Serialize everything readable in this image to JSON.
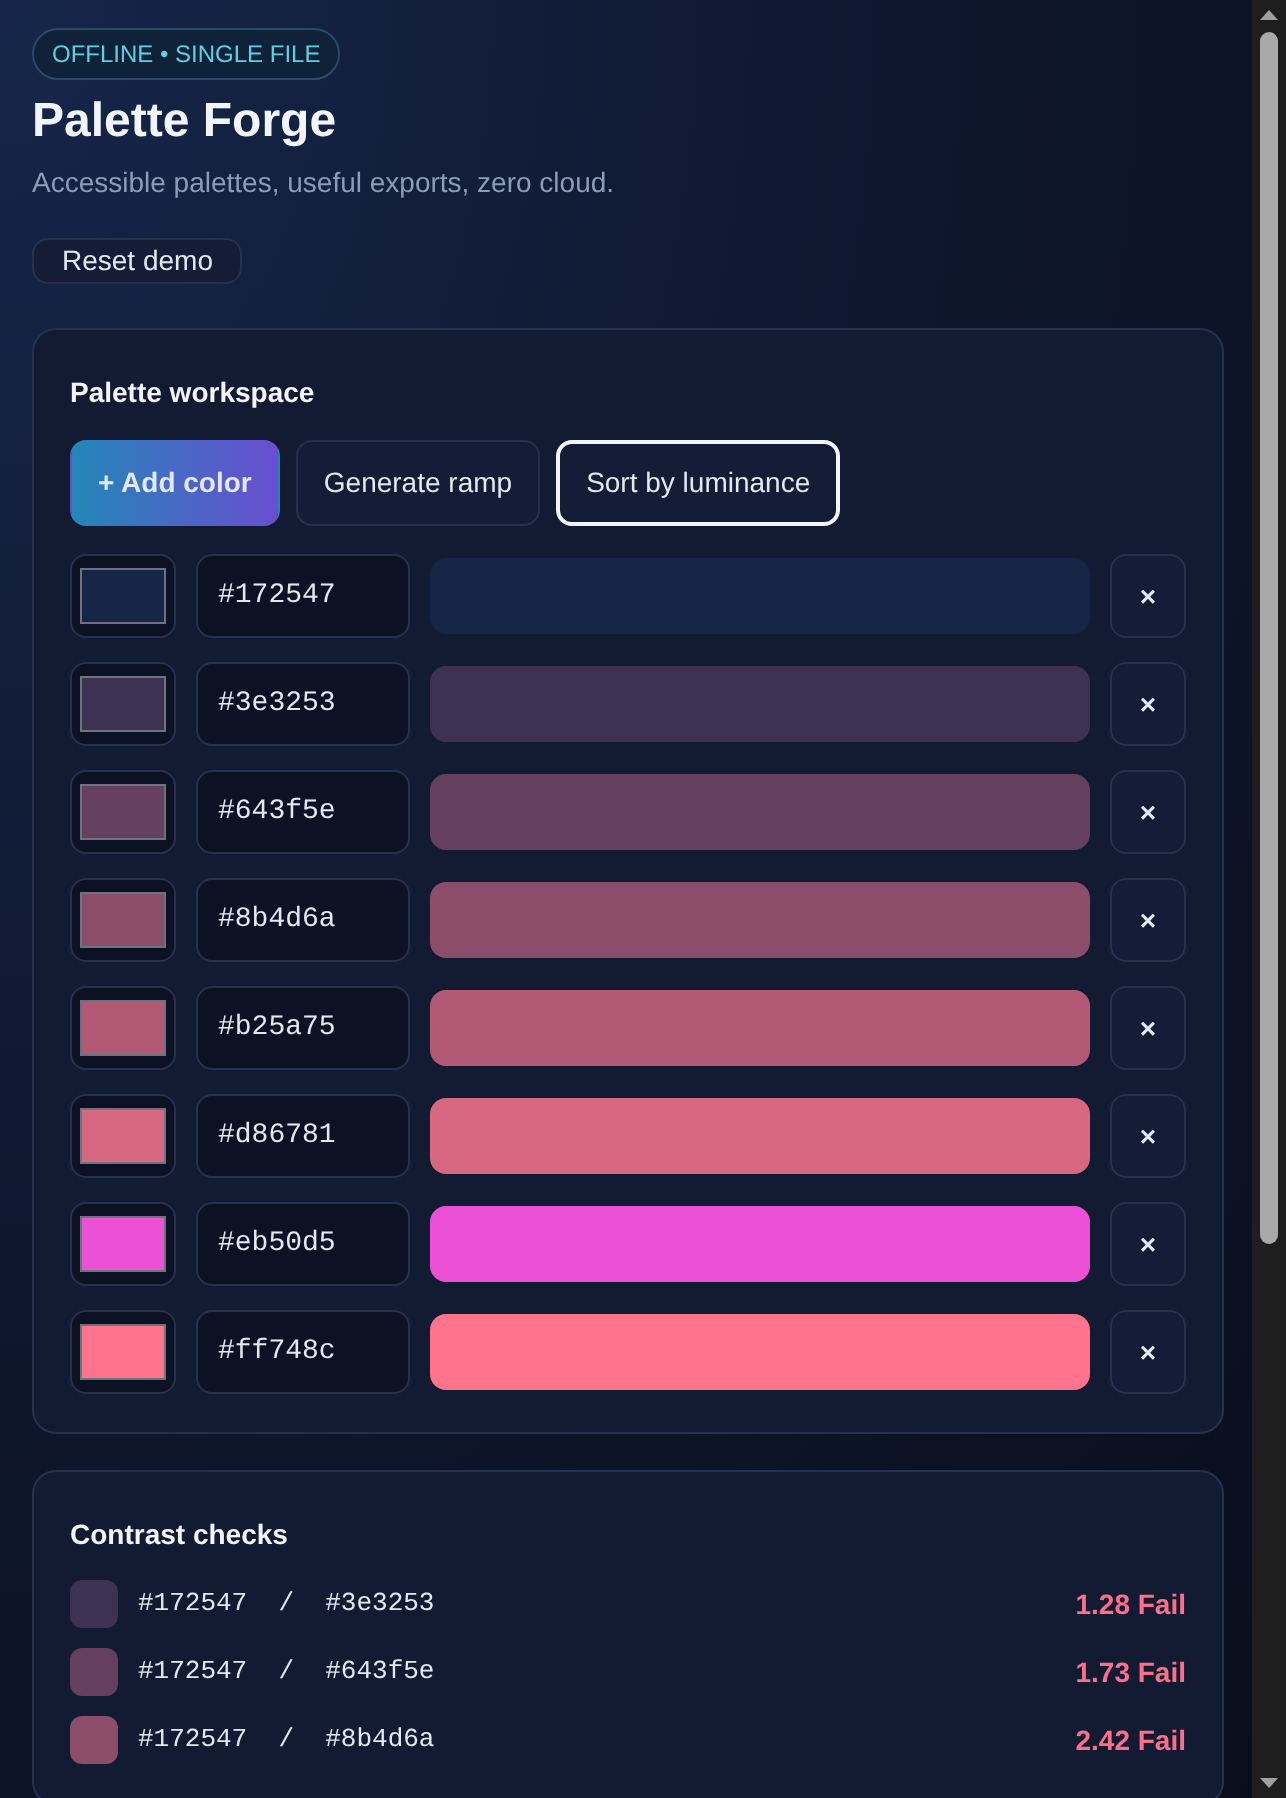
{
  "badge": "OFFLINE • SINGLE FILE",
  "title": "Palette Forge",
  "subtitle": "Accessible palettes, useful exports, zero cloud.",
  "reset_button": "Reset demo",
  "workspace": {
    "title": "Palette workspace",
    "actions": [
      {
        "label": "+ Add color",
        "kind": "primary",
        "focused": false
      },
      {
        "label": "Generate ramp",
        "kind": "secondary",
        "focused": false
      },
      {
        "label": "Sort by luminance",
        "kind": "secondary",
        "focused": true
      }
    ],
    "delete_label": "×",
    "colors": [
      {
        "value": "#172547",
        "color": "#172547"
      },
      {
        "value": "#3e3253",
        "color": "#3e3253"
      },
      {
        "value": "#643f5e",
        "color": "#643f5e"
      },
      {
        "value": "#8b4d6a",
        "color": "#8b4d6a"
      },
      {
        "value": "#b25a75",
        "color": "#b25a75"
      },
      {
        "value": "#d86781",
        "color": "#d86781"
      },
      {
        "value": "#eb50d5",
        "color": "#eb50d5"
      },
      {
        "value": "#ff748c",
        "color": "#ff748c"
      }
    ]
  },
  "contrast": {
    "title": "Contrast checks",
    "rows": [
      {
        "pair": "#172547  /  #3e3253",
        "result": "1.28 Fail",
        "passed": false,
        "color": "#3e3253"
      },
      {
        "pair": "#172547  /  #643f5e",
        "result": "1.73 Fail",
        "passed": false,
        "color": "#643f5e"
      },
      {
        "pair": "#172547  /  #8b4d6a",
        "result": "2.42 Fail",
        "passed": false,
        "color": "#8b4d6a"
      }
    ]
  }
}
